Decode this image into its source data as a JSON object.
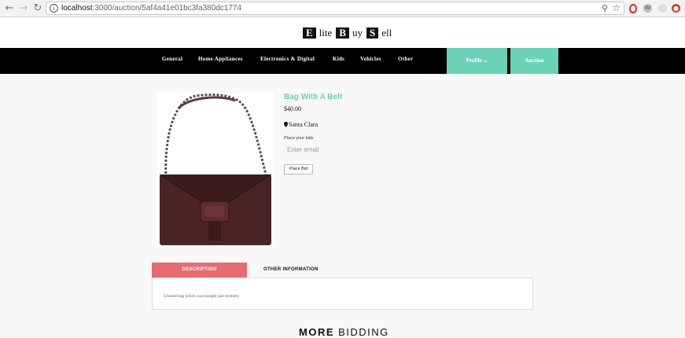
{
  "browser": {
    "url_host": "localhost",
    "url_path": ":3000/auction/5af4a41e01bc3fa380dc1774"
  },
  "site": {
    "logo": [
      {
        "initial": "E",
        "rest": "lite"
      },
      {
        "initial": "B",
        "rest": "uy"
      },
      {
        "initial": "S",
        "rest": "ell"
      }
    ]
  },
  "nav": {
    "items": [
      "General",
      "Home Appliances",
      "Electronics & Digital",
      "Kids",
      "Vehicles",
      "Other"
    ],
    "profile_label": "Profile ⌄",
    "auction_label": "Auction"
  },
  "product": {
    "title": "Bag With A Belt",
    "price": "$40.00",
    "location": "Santa Clara",
    "bids_label": "Place your bids",
    "email_placeholder": "Enter email",
    "place_bid_label": "Place Bid"
  },
  "tabs": {
    "description_label": "DESCRIPTION",
    "other_label": "OTHER INFORMATION",
    "description_text": "Unused bag which was bought just recently"
  },
  "more": {
    "bold": "MORE",
    "light": " BIDDING"
  },
  "colors": {
    "accent_green": "#6ad3b7",
    "accent_red": "#e66b6f"
  }
}
